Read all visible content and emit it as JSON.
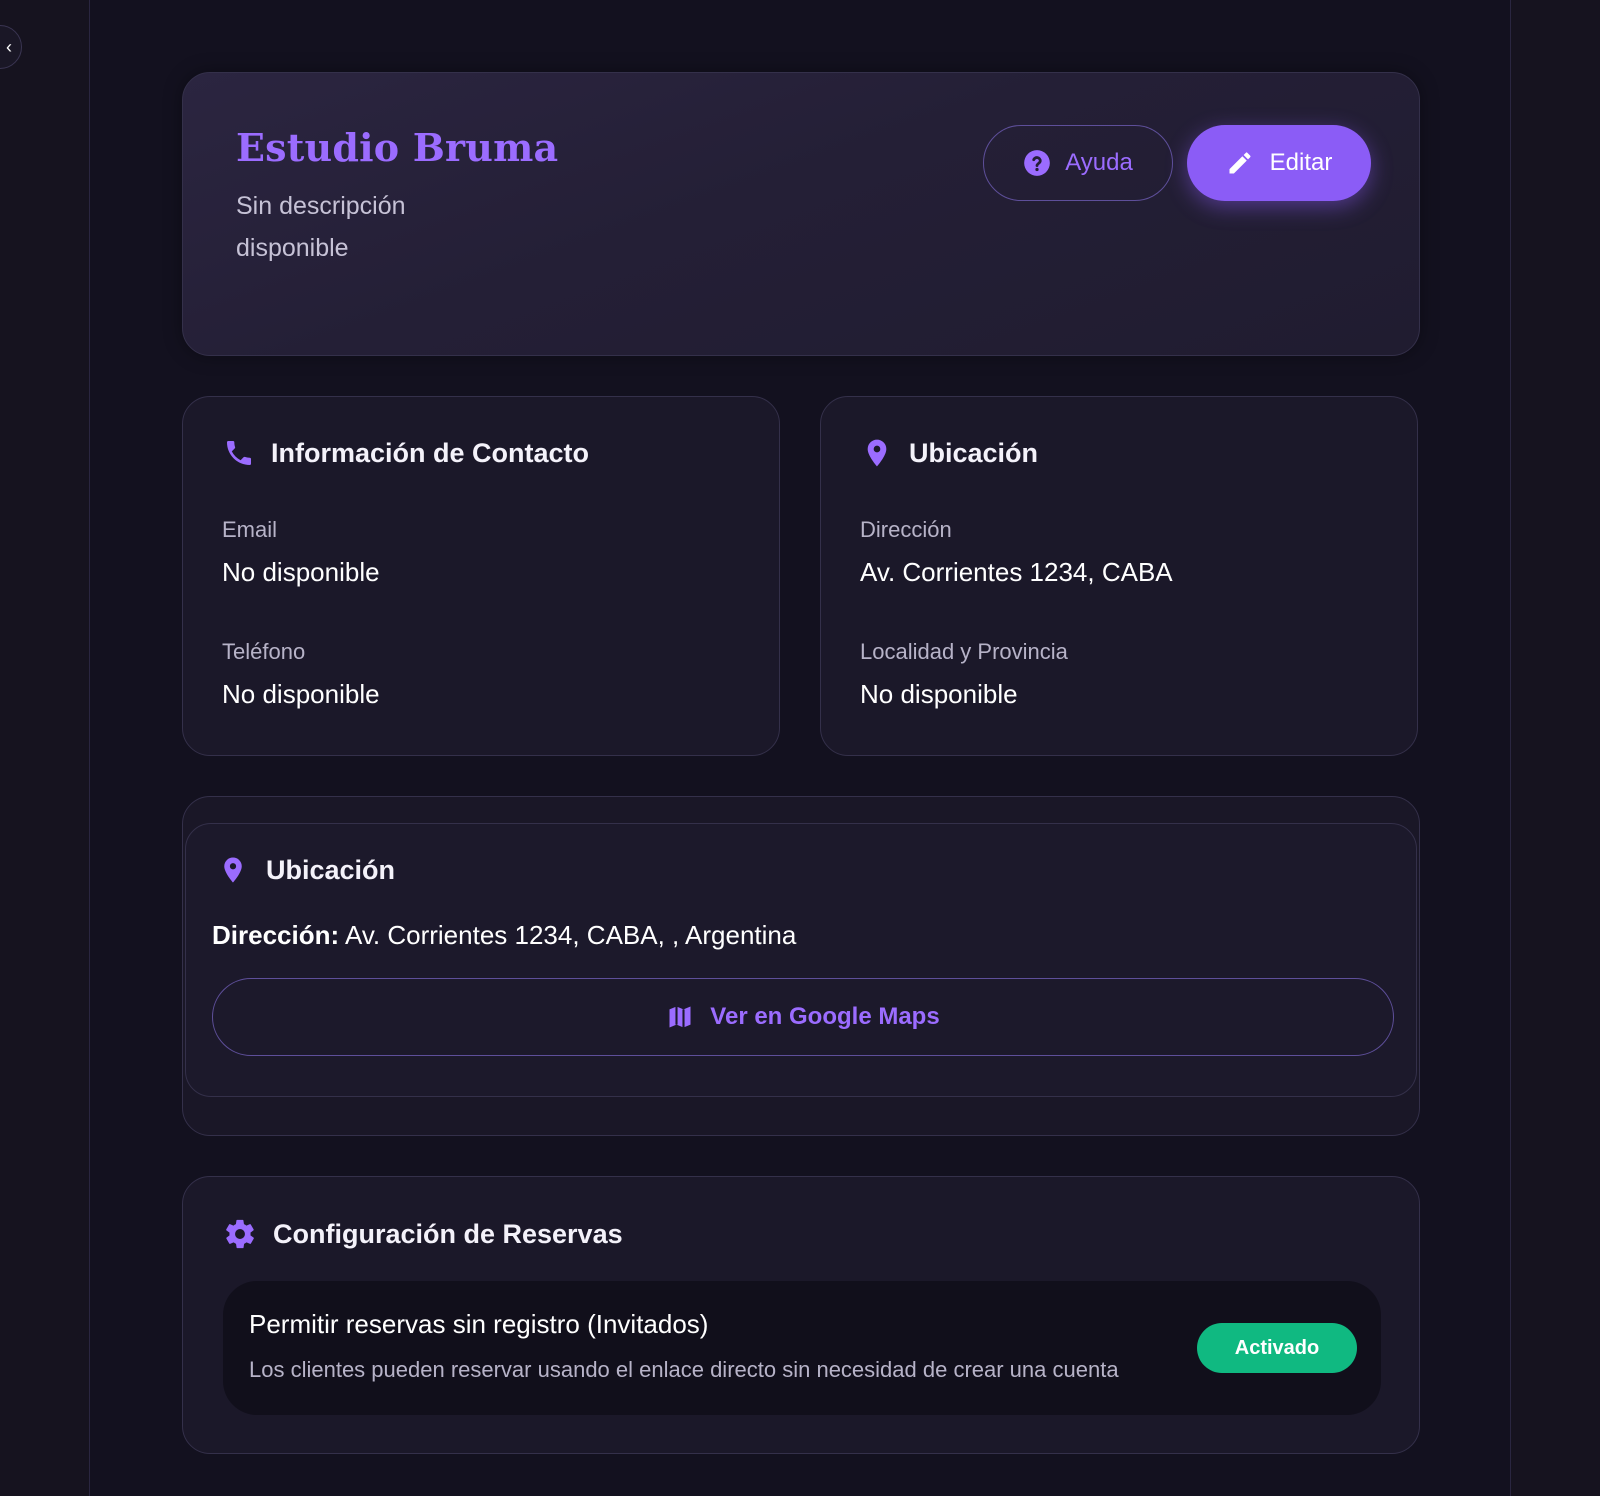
{
  "sidebar": {
    "collapse_glyph": "‹"
  },
  "hero": {
    "title": "Estudio Bruma",
    "description": "Sin descripción disponible",
    "help_label": "Ayuda",
    "edit_label": "Editar"
  },
  "contact": {
    "title": "Información de Contacto",
    "fields": [
      {
        "label": "Email",
        "value": "No disponible"
      },
      {
        "label": "Teléfono",
        "value": "No disponible"
      }
    ]
  },
  "location": {
    "title": "Ubicación",
    "fields": [
      {
        "label": "Dirección",
        "value": "Av. Corrientes 1234, CABA"
      },
      {
        "label": "Localidad y Provincia",
        "value": "No disponible"
      }
    ]
  },
  "map": {
    "title": "Ubicación",
    "address_label": "Dirección:",
    "address_value": "Av. Corrientes 1234, CABA, , Argentina",
    "button_label": "Ver en Google Maps"
  },
  "booking": {
    "title": "Configuración de Reservas",
    "option_title": "Permitir reservas sin registro (Invitados)",
    "option_desc": "Los clientes pueden reservar usando el enlace directo sin necesidad de crear una cuenta",
    "status_label": "Activado"
  },
  "colors": {
    "accent": "#8b5cf6",
    "accent_text": "#9b6cff",
    "success": "#10b981",
    "background": "#13111f",
    "card": "#1b1829"
  },
  "icons": {
    "help": "help-circle-icon",
    "edit": "pencil-icon",
    "contact": "phone-icon",
    "location": "map-pin-icon",
    "maps": "map-icon",
    "booking": "gear-icon"
  }
}
